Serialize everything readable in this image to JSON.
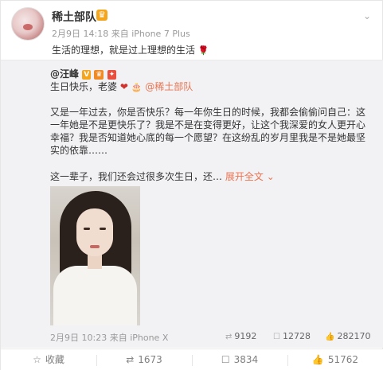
{
  "post": {
    "username": "稀土部队",
    "user_badge": "vip-crown-icon",
    "timestamp": "2月9日 14:18",
    "source": "来自 iPhone 7 Plus",
    "text": "生活的理想，就是过上理想的生活",
    "text_emoji": "rose-icon"
  },
  "repost": {
    "author": "@汪峰",
    "line2_text": "生日快乐，老婆",
    "mention": "@稀土部队",
    "paragraph": "又是一年过去，你是否快乐？每一年你生日的时候，我都会偷偷问自己：这一年她是不是更快乐了？我是不是在变得更好，让这个我深爱的女人更开心幸福？我是否知道她心底的每一个愿望？在这纷乱的岁月里我是不是她最坚实的依靠……",
    "line3_text": "这一辈子，我们还会过很多次生日，还…",
    "expand_label": "展开全文",
    "expand_icon": "chevron-down-icon",
    "footer": {
      "timestamp": "2月9日 10:23",
      "source": "来自 iPhone X",
      "reposts": "9192",
      "comments": "12728",
      "likes": "282170"
    }
  },
  "toolbar": {
    "favorite_label": "收藏",
    "repost_count": "1673",
    "comment_count": "3834",
    "like_count": "51762"
  },
  "colors": {
    "accent": "#eb7350",
    "repost_bg": "#f2f2f5",
    "meta_text": "#999999"
  }
}
